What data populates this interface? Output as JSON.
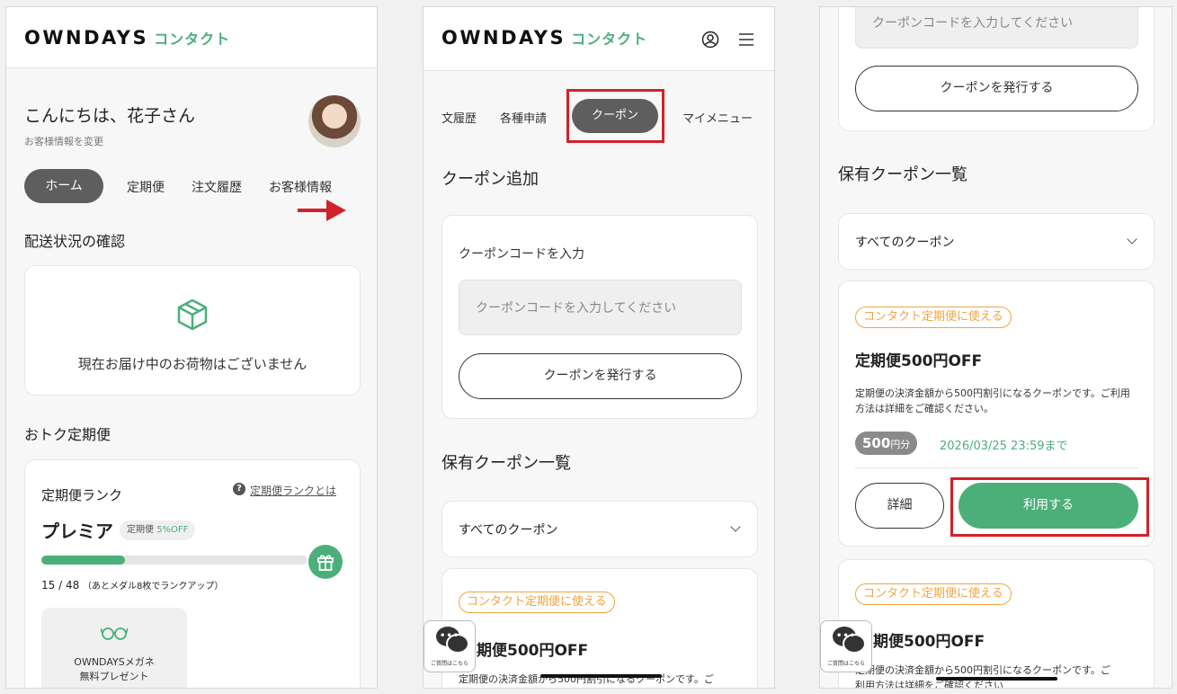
{
  "brand": {
    "logo": "OWNDAYS",
    "sub": "コンタクト"
  },
  "colors": {
    "green": "#4caf7a",
    "orange": "#f0a442",
    "red_highlight": "#d0222a",
    "dark_pill": "#5e5e5e"
  },
  "screen1": {
    "greeting": "こんにちは、花子さん",
    "edit_info": "お客様情報を変更",
    "tabs": [
      "ホーム",
      "定期便",
      "注文履歴",
      "お客様情報"
    ],
    "delivery_title": "配送状況の確認",
    "delivery_icon": "package-icon",
    "delivery_empty": "現在お届け中のお荷物はございません",
    "subscription_title": "おトク定期便",
    "rank_label": "定期便ランク",
    "rank_help": "定期便ランクとは",
    "rank_name": "プレミア",
    "rank_badge_prefix": "定期便 ",
    "rank_badge_value": "5%OFF",
    "progress_fraction": 0.3125,
    "progress_text": "15 / 48",
    "progress_note": "（あとメダル8枚でランクアップ）",
    "gift_icon": "gift-icon",
    "reward_icon": "glasses-icon",
    "reward_line1": "OWNDAYSメガネ",
    "reward_line2": "無料プレゼント"
  },
  "screen2": {
    "account_icon": "user-icon",
    "menu_icon": "hamburger-icon",
    "tabs": [
      "文履歴",
      "各種申請",
      "クーポン",
      "マイメニュー"
    ],
    "add_title": "クーポン追加",
    "code_label": "クーポンコードを入力",
    "code_placeholder": "クーポンコードを入力してください",
    "issue_button": "クーポンを発行する",
    "list_title": "保有クーポン一覧",
    "filter_value": "すべてのクーポン",
    "coupon_tag": "コンタクト定期便に使える",
    "coupon_title": "期便500円OFF",
    "coupon_desc": "定期便の決済金額から500円割引になるクーポンです。ご",
    "chat_label": "ご質問はこちら"
  },
  "screen3": {
    "code_placeholder": "クーポンコードを入力してください",
    "issue_button": "クーポンを発行する",
    "list_title": "保有クーポン一覧",
    "filter_value": "すべてのクーポン",
    "coupon_tag": "コンタクト定期便に使える",
    "coupon_title": "定期便500円OFF",
    "coupon_desc": "定期便の決済金額から500円割引になるクーポンです。ご利用方法は詳細をご確認ください。",
    "amount_value": "500",
    "amount_unit": "円分",
    "expiry": "2026/03/25 23:59まで",
    "detail_button": "詳細",
    "use_button": "利用する",
    "coupon2_tag": "コンタクト定期便に使える",
    "coupon2_title": "期便500円OFF",
    "coupon2_desc": "定期便の決済金額から500円割引になるクーポンです。ご",
    "coupon2_desc2": "利用方法は詳細をご確認ください",
    "chat_label": "ご質問はこちら"
  }
}
